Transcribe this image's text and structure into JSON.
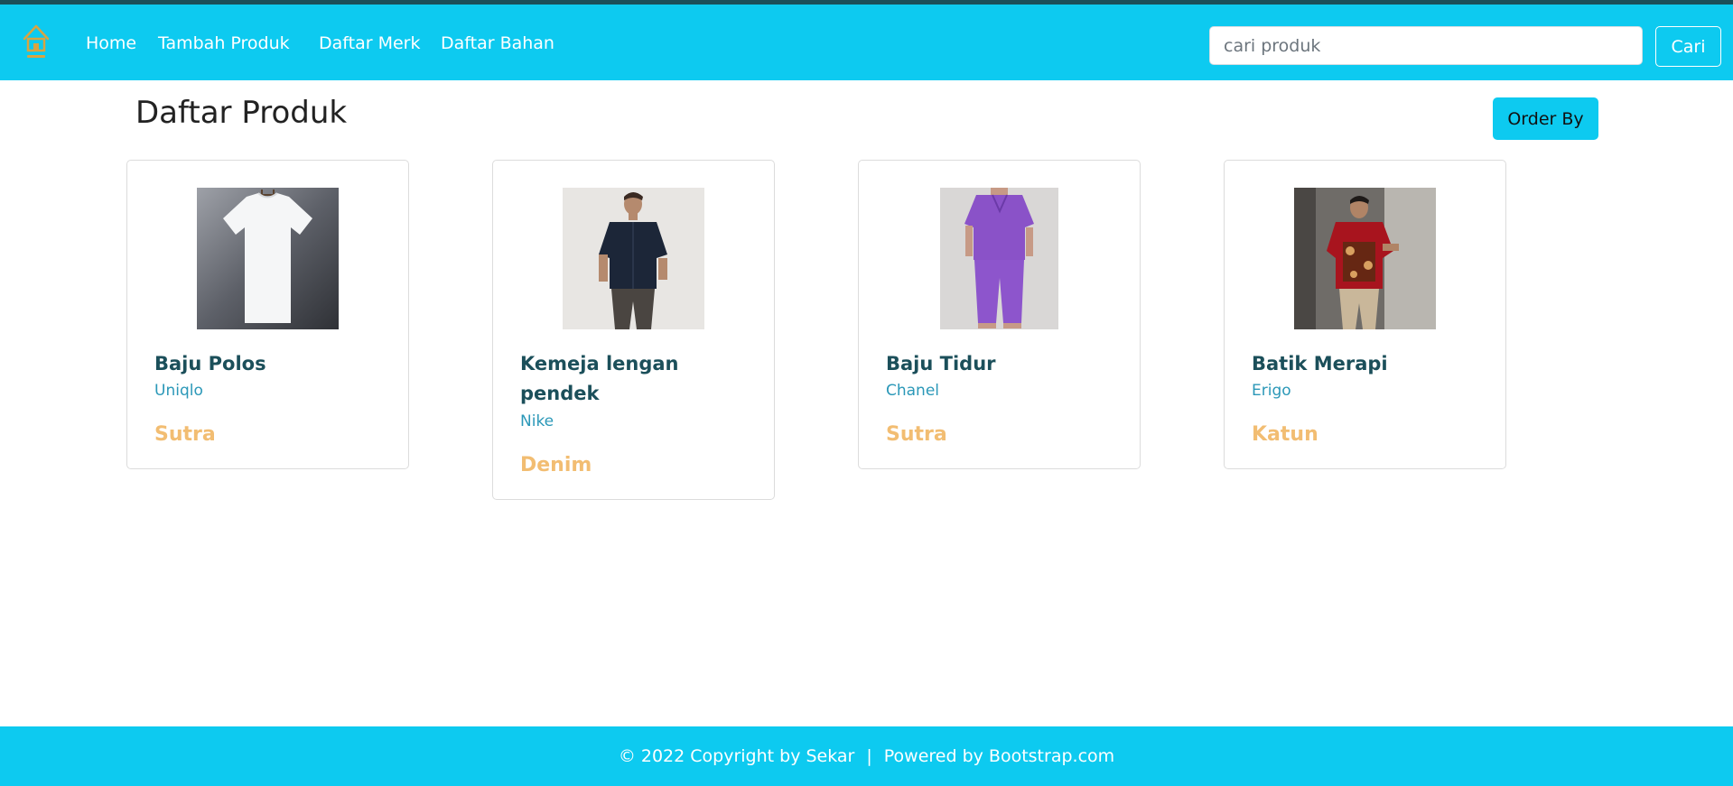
{
  "colors": {
    "accent": "#0dcaf0",
    "top_line": "#1b4f5a",
    "product_name": "#1b4f5a",
    "brand_text": "#2b98b8",
    "material_text": "#f2bd72",
    "logo": "#d9a441"
  },
  "navbar": {
    "logo_icon": "home-icon",
    "links": [
      "Home",
      "Tambah Produk",
      "Daftar Merk",
      "Daftar Bahan"
    ],
    "search": {
      "placeholder": "cari produk",
      "value": ""
    },
    "search_button": "Cari"
  },
  "main": {
    "title": "Daftar Produk",
    "order_button": "Order By",
    "products": [
      {
        "name": "Baju Polos",
        "brand": "Uniqlo",
        "material": "Sutra",
        "image": "white-tshirt-photo"
      },
      {
        "name": "Kemeja lengan pendek",
        "brand": "Nike",
        "material": "Denim",
        "image": "navy-short-sleeve-shirt-photo"
      },
      {
        "name": "Baju Tidur",
        "brand": "Chanel",
        "material": "Sutra",
        "image": "purple-pajamas-photo"
      },
      {
        "name": "Batik Merapi",
        "brand": "Erigo",
        "material": "Katun",
        "image": "red-batik-shirt-photo"
      }
    ]
  },
  "footer": {
    "copyright": "© 2022 Copyright by Sekar",
    "separator": "|",
    "powered": "Powered by Bootstrap.com"
  }
}
